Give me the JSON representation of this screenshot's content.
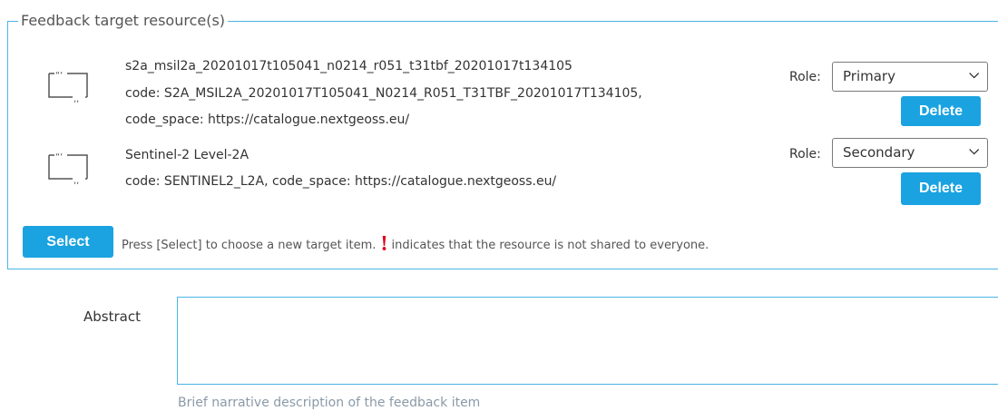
{
  "fieldset": {
    "legend": "Feedback target resource(s)"
  },
  "resources": [
    {
      "icon": "quote-frame-icon",
      "title": "s2a_msil2a_20201017t105041_n0214_r051_t31tbf_20201017t134105",
      "code_line": "code: S2A_MSIL2A_20201017T105041_N0214_R051_T31TBF_20201017T134105,",
      "code_space_line": "code_space: https://catalogue.nextgeoss.eu/",
      "role_label": "Role:",
      "role": "Primary",
      "delete_label": "Delete"
    },
    {
      "icon": "quote-frame-icon",
      "title": "Sentinel-2 Level-2A",
      "code_line": "code: SENTINEL2_L2A, code_space: https://catalogue.nextgeoss.eu/",
      "role_label": "Role:",
      "role": "Secondary",
      "delete_label": "Delete"
    }
  ],
  "select_button": "Select",
  "hint": {
    "before": "Press [Select] to choose a new target item.",
    "mark": "!",
    "after": "indicates that the resource is not shared to everyone."
  },
  "abstract": {
    "label": "Abstract",
    "value": "",
    "help": "Brief narrative description of the feedback item"
  },
  "colors": {
    "accent": "#1aa3e0",
    "border": "#4bb4e6",
    "warning": "#e0001a"
  }
}
